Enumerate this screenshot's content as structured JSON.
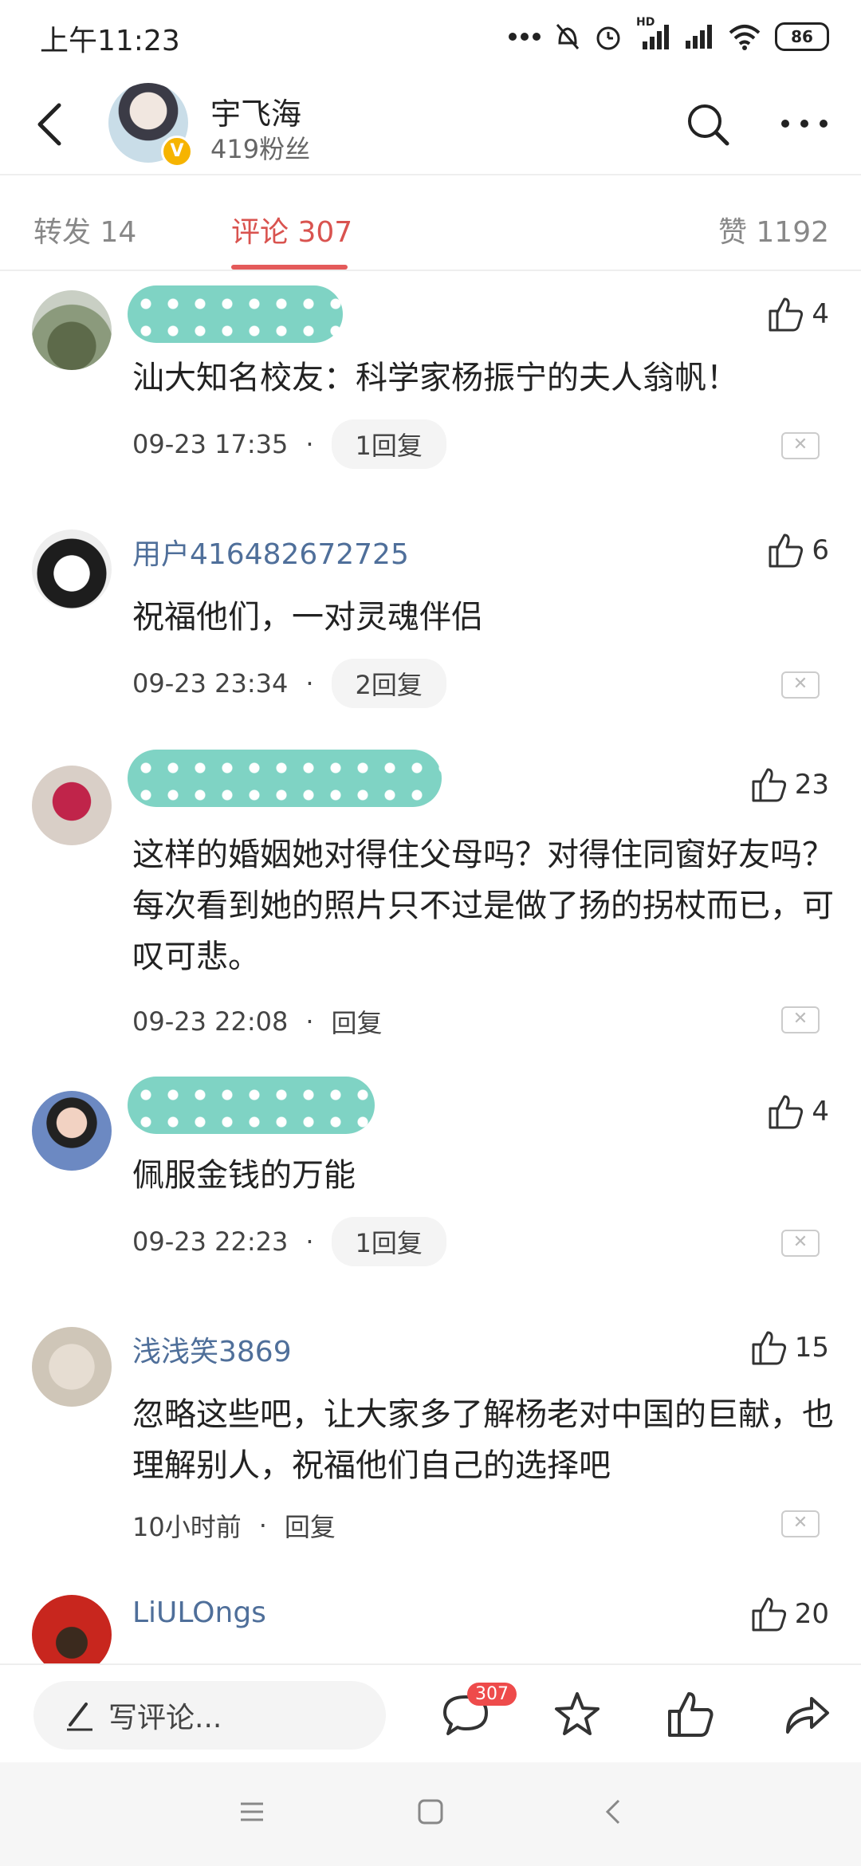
{
  "status_bar": {
    "time": "上午11:23",
    "battery": "86",
    "network_label": "HD"
  },
  "header": {
    "author_name": "宇飞海",
    "author_fans": "419粉丝",
    "verified_badge": "V"
  },
  "tabs": {
    "repost": "转发 14",
    "comments": "评论 307",
    "likes": "赞 1192"
  },
  "comments": [
    {
      "username": "",
      "likes": "4",
      "text": "汕大知名校友：科学家杨振宁的夫人翁帆！",
      "time": "09-23 17:35",
      "reply": "1回复"
    },
    {
      "username": "用户416482672725",
      "likes": "6",
      "text": "祝福他们，一对灵魂伴侣",
      "time": "09-23 23:34",
      "reply": "2回复"
    },
    {
      "username": "",
      "likes": "23",
      "text": "这样的婚姻她对得住父母吗？对得住同窗好友吗？每次看到她的照片只不过是做了扬的拐杖而已，可叹可悲。",
      "time": "09-23 22:08",
      "reply": "回复"
    },
    {
      "username": "",
      "likes": "4",
      "text": "佩服金钱的万能",
      "time": "09-23 22:23",
      "reply": "1回复"
    },
    {
      "username": "浅浅笑3869",
      "likes": "15",
      "text": "忽略这些吧，让大家多了解杨老对中国的巨献，也理解别人，祝福他们自己的选择吧",
      "time": "10小时前",
      "reply": "回复"
    },
    {
      "username": "LiULOngs",
      "likes": "20"
    }
  ],
  "meta_separator": "·",
  "bottom_bar": {
    "compose_placeholder": "写评论...",
    "comment_count_badge": "307"
  },
  "icons": {
    "back": "back-arrow-icon",
    "search": "search-icon",
    "more": "more-icon",
    "like": "thumbs-up-icon",
    "close": "close-icon",
    "comment": "comment-icon",
    "favorite": "star-icon",
    "share": "share-icon"
  },
  "colors": {
    "accent": "#e45a5a",
    "username": "#4f6f9a",
    "redaction": "#7fd3c4"
  }
}
